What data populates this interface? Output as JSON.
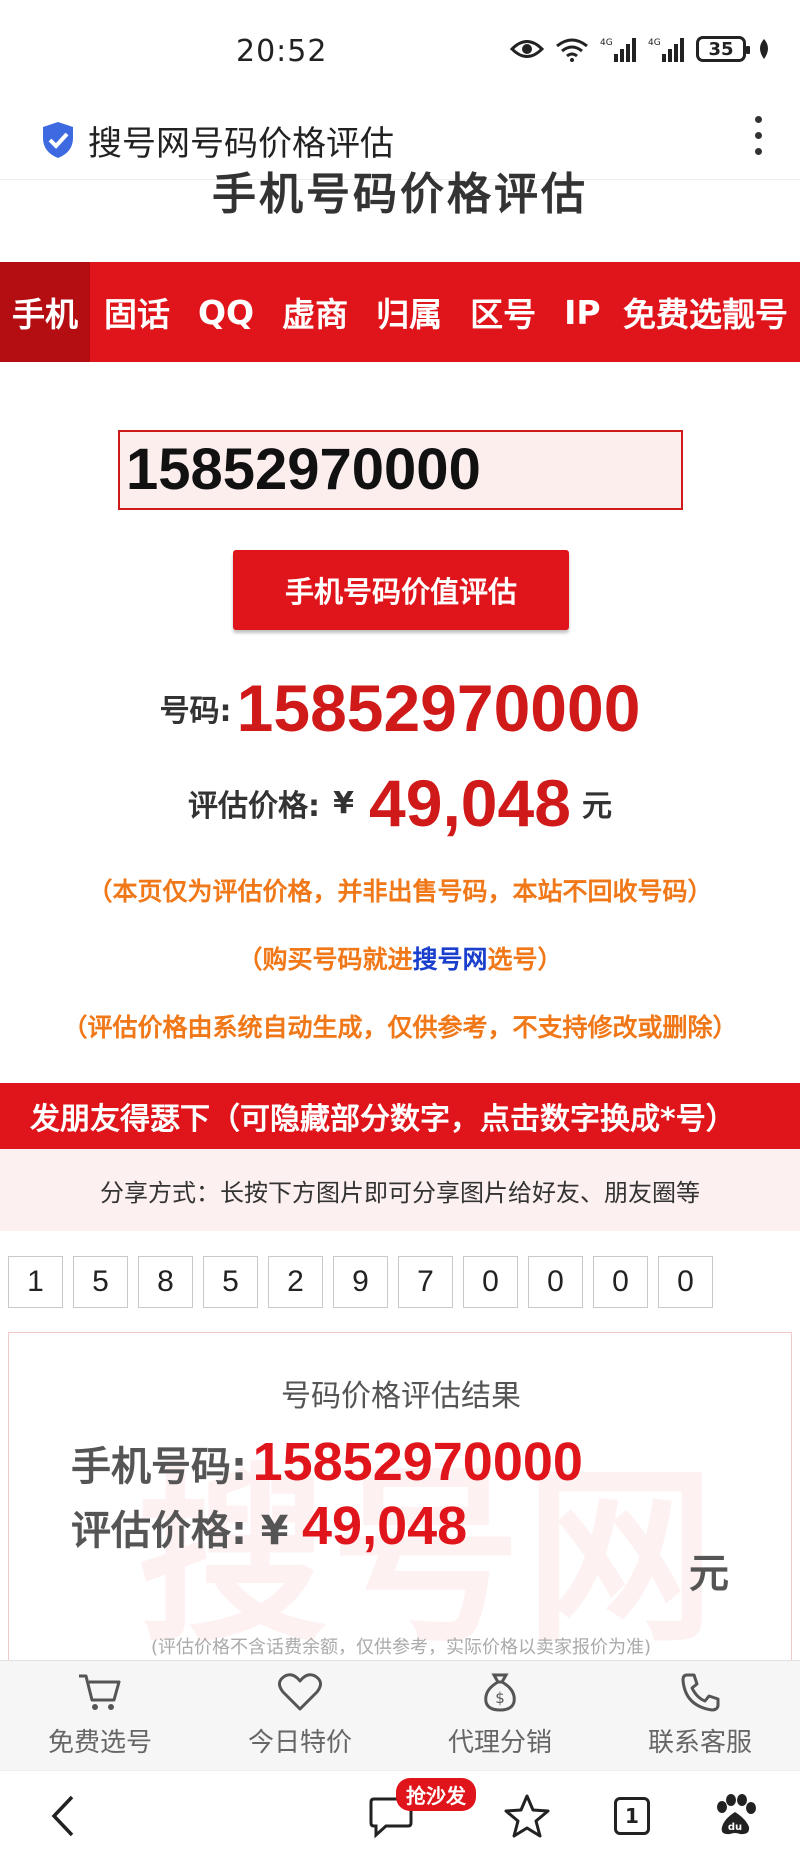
{
  "status_bar": {
    "time": "20:52",
    "battery": "35",
    "net1": "4G",
    "net2": "4G",
    "wifi_tag": "6"
  },
  "browser": {
    "page_title": "搜号网号码价格评估"
  },
  "site": {
    "header_title": "手机号码价格评估"
  },
  "nav_tabs": [
    "手机",
    "固话",
    "QQ",
    "虚商",
    "归属",
    "区号",
    "IP",
    "免费选靓号"
  ],
  "search": {
    "value": "15852970000"
  },
  "evaluate_button": "手机号码价值评估",
  "result": {
    "number_label": "号码:",
    "number": "15852970000",
    "price_label": "评估价格:",
    "currency": "¥",
    "price": "49,048",
    "unit": "元"
  },
  "notices": {
    "line1": "（本页仅为评估价格，并非出售号码，本站不回收号码）",
    "line2_prefix": "（购买号码就进",
    "line2_link": "搜号网",
    "line2_suffix": "选号）",
    "line3": "（评估价格由系统自动生成，仅供参考，不支持修改或删除）"
  },
  "share": {
    "bar_text": "发朋友得瑟下（可隐藏部分数字，点击数字换成*号）",
    "method_text": "分享方式：长按下方图片即可分享图片给好友、朋友圈等"
  },
  "digits": [
    "1",
    "5",
    "8",
    "5",
    "2",
    "9",
    "7",
    "0",
    "0",
    "0",
    "0"
  ],
  "card": {
    "title": "号码价格评估结果",
    "watermark": "搜号网",
    "phone_label": "手机号码:",
    "phone": "15852970000",
    "price_label": "评估价格:",
    "currency": "¥",
    "price": "49,048",
    "unit": "元",
    "fine_print": "(评估价格不含话费余额，仅供参考，实际价格以卖家报价为准)"
  },
  "site_nav": [
    {
      "label": "免费选号",
      "icon": "cart-icon"
    },
    {
      "label": "今日特价",
      "icon": "heart-icon"
    },
    {
      "label": "代理分销",
      "icon": "money-bag-icon"
    },
    {
      "label": "联系客服",
      "icon": "phone-icon"
    }
  ],
  "toolbar": {
    "badge": "抢沙发",
    "tab_count": "1"
  },
  "colors": {
    "brand_red": "#e0151b",
    "notice_orange": "#f07818",
    "link_blue": "#1a3fcc"
  }
}
